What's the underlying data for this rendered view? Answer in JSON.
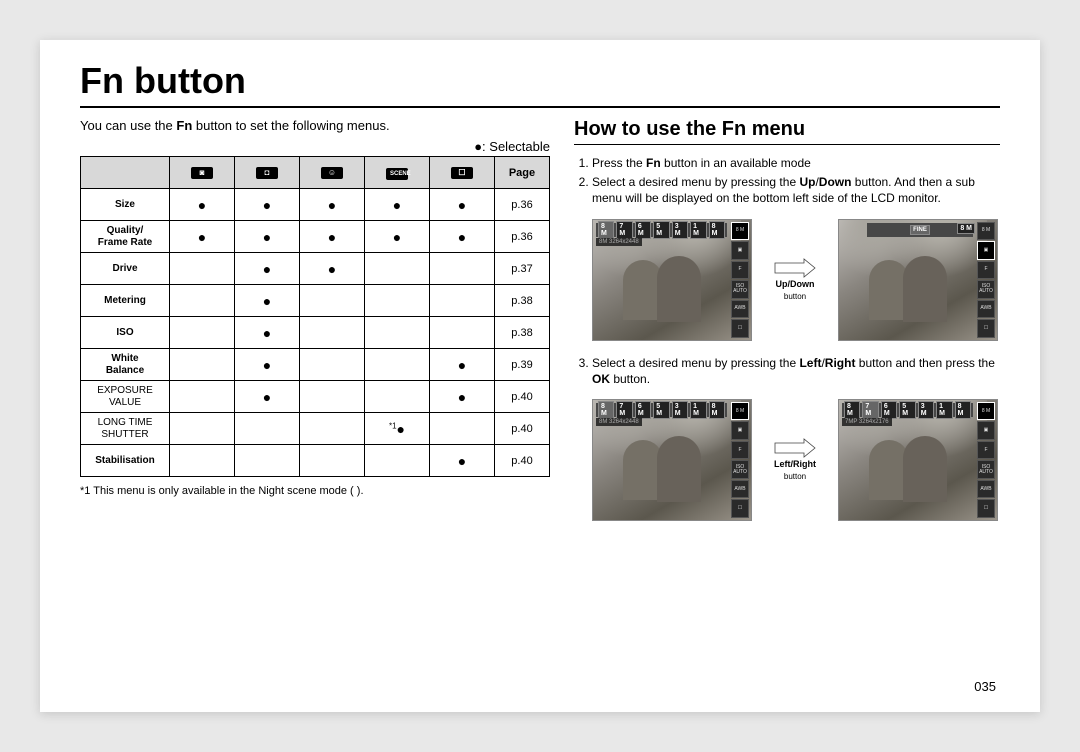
{
  "title": "Fn button",
  "intro_pre": "You can use the ",
  "intro_bold": "Fn",
  "intro_post": " button to set the following menus.",
  "legend": "●: Selectable",
  "table": {
    "header_page": "Page",
    "rows": [
      {
        "label": "Size",
        "bold": true,
        "cells": [
          "●",
          "●",
          "●",
          "●",
          "●"
        ],
        "page": "p.36"
      },
      {
        "label": "Quality/\nFrame Rate",
        "bold": true,
        "cells": [
          "●",
          "●",
          "●",
          "●",
          "●"
        ],
        "page": "p.36"
      },
      {
        "label": "Drive",
        "bold": true,
        "cells": [
          "",
          "●",
          "●",
          "",
          ""
        ],
        "page": "p.37"
      },
      {
        "label": "Metering",
        "bold": true,
        "cells": [
          "",
          "●",
          "",
          "",
          ""
        ],
        "page": "p.38"
      },
      {
        "label": "ISO",
        "bold": true,
        "cells": [
          "",
          "●",
          "",
          "",
          ""
        ],
        "page": "p.38"
      },
      {
        "label": "White\nBalance",
        "bold": true,
        "cells": [
          "",
          "●",
          "",
          "",
          "●"
        ],
        "page": "p.39"
      },
      {
        "label": "EXPOSURE\nVALUE",
        "bold": false,
        "cells": [
          "",
          "●",
          "",
          "",
          "●"
        ],
        "page": "p.40"
      },
      {
        "label": "LONG TIME\nSHUTTER",
        "bold": false,
        "cells": [
          "",
          "",
          "",
          "*1●",
          ""
        ],
        "page": "p.40"
      },
      {
        "label": "Stabilisation",
        "bold": true,
        "cells": [
          "",
          "",
          "",
          "",
          "●"
        ],
        "page": "p.40"
      }
    ]
  },
  "footnote": "*1 This menu is only available in the Night scene mode (    ).",
  "section_title": "How to use the Fn menu",
  "steps_a": {
    "s1_pre": "Press the ",
    "s1_b": "Fn",
    "s1_post": " button in an available mode",
    "s2_pre": "Select a desired menu by pressing the ",
    "s2_b1": "Up",
    "s2_sep": "/",
    "s2_b2": "Down",
    "s2_post": " button. And then a sub menu will be displayed on the bottom left side of the LCD monitor."
  },
  "steps_b": {
    "s3_pre": "Select a desired menu by pressing the ",
    "s3_b1": "Left",
    "s3_sep": "/",
    "s3_b2": "Right",
    "s3_post1": " button and then press the ",
    "s3_b3": "OK",
    "s3_post2": " button."
  },
  "arrow1_label": "Up/Down",
  "arrow_button_label": "button",
  "arrow2_label": "Left/Right",
  "lcd": {
    "chips": [
      "8 M",
      "7 M",
      "6 M",
      "5 M",
      "3 M",
      "1 M"
    ],
    "chip_last": "8 M",
    "readout_8m": "8M 3264x2448",
    "readout_7m": "7MP 3264x2176",
    "side": [
      "8 M",
      "▣",
      "F",
      "ISO\nAUTO",
      "AWB",
      "☐"
    ],
    "side2_fine": "FINE",
    "side_hl_index_a": 0,
    "side_hl_index_b": 1
  },
  "page_number": "035"
}
